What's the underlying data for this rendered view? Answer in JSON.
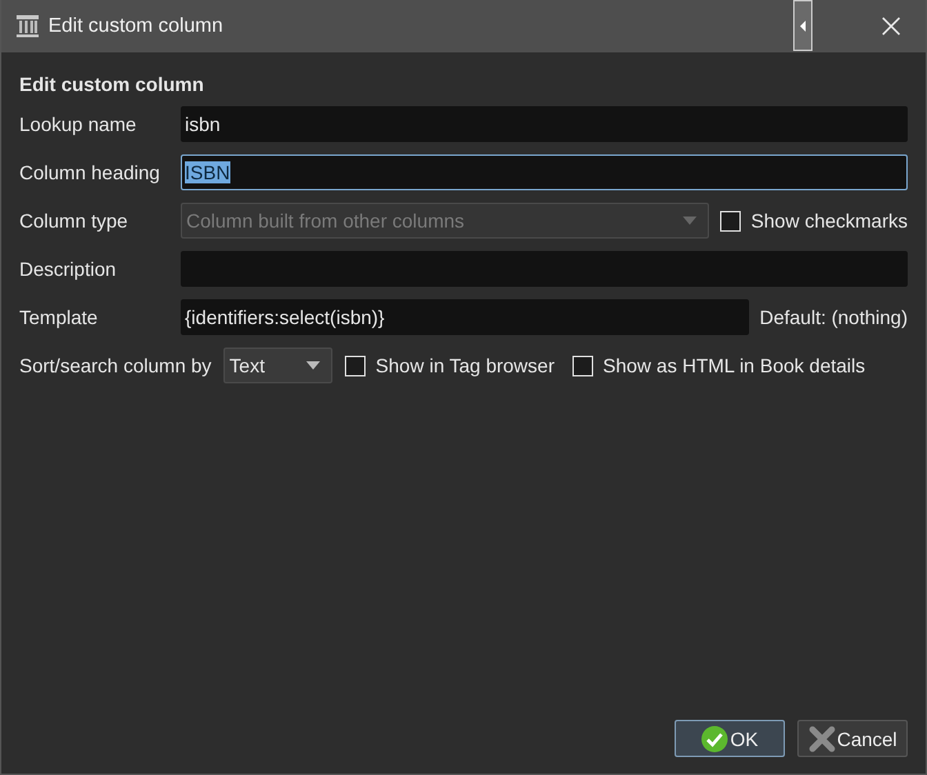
{
  "window": {
    "title": "Edit custom column"
  },
  "heading": "Edit custom column",
  "rows": [
    {
      "kind": "text",
      "label": "Lookup name",
      "value": "isbn",
      "focused": false
    },
    {
      "kind": "text",
      "label": "Column heading",
      "value": "ISBN",
      "focused": true,
      "text_selected": true
    },
    {
      "kind": "combo",
      "label": "Column type",
      "value": "Column built from other columns",
      "disabled": true,
      "checkboxes": [
        {
          "label": "Show checkmarks",
          "checked": false
        }
      ]
    },
    {
      "kind": "text",
      "label": "Description",
      "focused": false
    },
    {
      "kind": "template",
      "label": "Template",
      "value": "{identifiers:select(isbn)}",
      "note": "Default: (nothing)"
    },
    {
      "kind": "sort",
      "label": "Sort/search column by",
      "value": "Text",
      "disabled": false,
      "checkboxes": [
        {
          "label": "Show in Tag browser",
          "checked": false
        },
        {
          "label": "Show as HTML in Book details",
          "checked": false
        }
      ]
    }
  ],
  "buttons": [
    {
      "kind": "ok",
      "label": "OK",
      "default": true
    },
    {
      "kind": "cancel",
      "label": "Cancel",
      "default": false
    }
  ]
}
